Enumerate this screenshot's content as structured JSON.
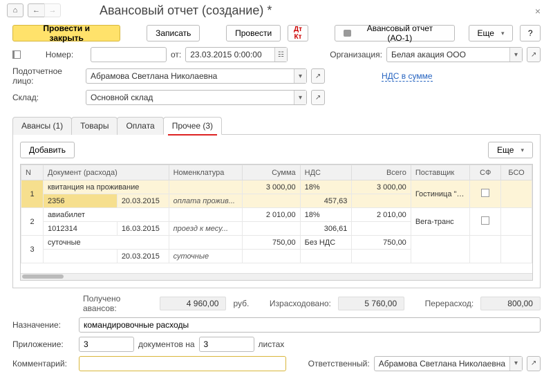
{
  "title": "Авансовый отчет (создание) *",
  "toolbar": {
    "post_close": "Провести и закрыть",
    "save": "Записать",
    "post": "Провести",
    "print_label": "Авансовый отчет (АО-1)",
    "more": "Еще",
    "help": "?"
  },
  "fields": {
    "number_label": "Номер:",
    "number": "",
    "date_label": "от:",
    "date": "23.03.2015  0:00:00",
    "org_label": "Организация:",
    "org": "Белая акация ООО",
    "person_label": "Подотчетное лицо:",
    "person": "Абрамова Светлана Николаевна",
    "vat_link": "НДС в сумме",
    "warehouse_label": "Склад:",
    "warehouse": "Основной склад"
  },
  "tabs": {
    "advances": "Авансы (1)",
    "goods": "Товары",
    "payment": "Оплата",
    "other": "Прочее (3)"
  },
  "subtoolbar": {
    "add": "Добавить",
    "more": "Еще"
  },
  "columns": {
    "n": "N",
    "doc": "Документ (расхода)",
    "nomen": "Номенклатура",
    "sum": "Сумма",
    "vat": "НДС",
    "total": "Всего",
    "supplier": "Поставщик",
    "sf": "СФ",
    "bso": "БСО"
  },
  "rows": [
    {
      "n": "1",
      "doc_name": "квитанция на проживание",
      "doc_num": "2356",
      "doc_date": "20.03.2015",
      "nomen": "оплата прожив...",
      "sum": "3 000,00",
      "vat_rate": "18%",
      "vat_amount": "457,63",
      "total": "3 000,00",
      "supplier": "Гостиница \"Заря\""
    },
    {
      "n": "2",
      "doc_name": "авиабилет",
      "doc_num": "1012314",
      "doc_date": "16.03.2015",
      "nomen": "проезд к месу...",
      "sum": "2 010,00",
      "vat_rate": "18%",
      "vat_amount": "306,61",
      "total": "2 010,00",
      "supplier": "Вега-транс"
    },
    {
      "n": "3",
      "doc_name": "суточные",
      "doc_num": "",
      "doc_date": "20.03.2015",
      "nomen": "суточные",
      "sum": "750,00",
      "vat_rate": "Без НДС",
      "vat_amount": "",
      "total": "750,00",
      "supplier": ""
    }
  ],
  "totals": {
    "advance_label": "Получено авансов:",
    "advance": "4 960,00",
    "currency": "руб.",
    "spent_label": "Израсходовано:",
    "spent": "5 760,00",
    "over_label": "Перерасход:",
    "over": "800,00"
  },
  "bottom": {
    "purpose_label": "Назначение:",
    "purpose": "командировочные расходы",
    "attach_label": "Приложение:",
    "attach_docs": "3",
    "attach_docs_label": "документов на",
    "attach_pages": "3",
    "attach_pages_label": "листах",
    "comment_label": "Комментарий:",
    "comment": "",
    "responsible_label": "Ответственный:",
    "responsible": "Абрамова Светлана Николаевна"
  }
}
